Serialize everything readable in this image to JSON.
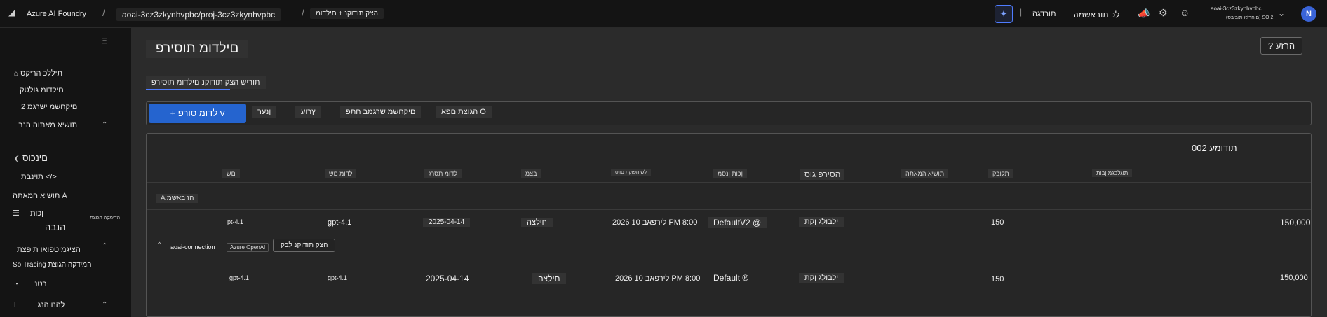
{
  "topbar": {
    "brand": "Azure AI Foundry",
    "project": "aoai-3cz3zkynhvpbc/proj-3cz3zkynhvpbc",
    "page": "הצק תודוקנ + םילדומ",
    "settings_label": "תורדגה",
    "all_resources_label": "לכ תובאשמה",
    "user_name": "aoai-3cz3zkynhvpbc",
    "user_sub": "(םיחרזא תוביבס) SO 2",
    "avatar_initial": "N"
  },
  "sidebar": {
    "items": [
      {
        "label": "תיללכ הריקס",
        "icon": "home-icon"
      },
      {
        "label": "םילדומ גולטק",
        "icon": "catalog-icon"
      },
      {
        "label": "םיקחשמ ישרגמ 2",
        "icon": "playground-icon"
      },
      {
        "label": "תושיא מאתוה הנב",
        "icon": "section-icon"
      },
      {
        "label": "םינכוס",
        "icon": "agents-icon"
      },
      {
        "label": "תוינבת </>",
        "icon": "code-icon"
      },
      {
        "label": "תושיא המאתה A",
        "icon": "finetune-icon"
      },
      {
        "label": "ןכות",
        "icon": "content-icon"
      },
      {
        "label": "הנבה",
        "icon": "build-icon"
      },
      {
        "label": "הציגמיטפואו תיפצת",
        "icon": "section-icon"
      },
      {
        "label": "So Tracing המידקה הגוצת",
        "icon": "tracing-icon"
      },
      {
        "label": "רטנ",
        "icon": "monitor-icon"
      },
      {
        "label": "להנו הנג",
        "icon": "protect-icon"
      }
    ],
    "sub_label": "הדימקה הגוצת"
  },
  "main": {
    "title": "םילדומ תוסירפ",
    "help_label": "? הרזע",
    "tab_label": "תוריש הצק תודוקנ םילדומ תוסירפ",
    "toolbar": {
      "deploy_label": "+ לדומ סורפ v",
      "refresh_label": "ןנער",
      "reset_label": "ץרוע",
      "columns_label": "םיקחשמ שרגמב חתפ",
      "filter_label": "הגוצת םפא O"
    },
    "count_label": "תודומע 002",
    "columns": [
      "םש",
      "לדומ םש",
      "לדומ תסרג",
      "בצמ",
      "לש הפוקת םויס",
      "ןכות ןנסמ",
      "הסירפ גוס",
      "תושיא המאתה",
      "תלובק",
      "תוגלבגמ ןבות"
    ],
    "group_label": "A הז באשמ",
    "rows": [
      {
        "name": "pt-4.1",
        "model": "gpt-4.1",
        "version": "2025-04-14",
        "state": "חילצה",
        "retirement": "לירפאב 10 2026 PM 8:00",
        "filter": "DefaultV2 @",
        "type": "ילבולג ןקת",
        "capacity": "150",
        "limit": "150,000"
      },
      {
        "name": "gpt-4.1",
        "model": "gpt-4.1",
        "version": "2025-04-14",
        "state": "חילצה",
        "retirement": "לירפאב 10 2026 PM 8:00",
        "filter": "Default ®",
        "type": "ילבולג ןקת",
        "capacity": "150",
        "limit": "150,000"
      }
    ],
    "connection": {
      "name": "aoai-connection",
      "kind": "Azure OpenAI",
      "get_endpoint": "הצק תודוקנ לבק"
    }
  },
  "colors": {
    "accent": "#2564cf",
    "background": "#2b2b2b",
    "sidebar": "#141414"
  }
}
